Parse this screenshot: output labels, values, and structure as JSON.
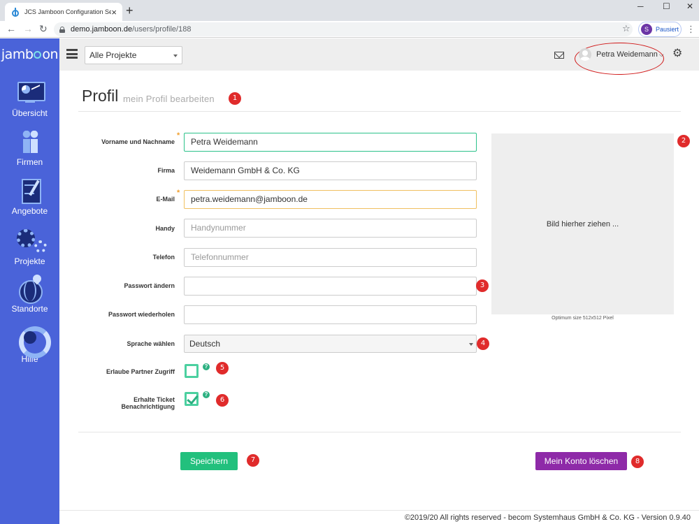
{
  "browser": {
    "tab_title": "JCS Jamboon Configuration Serv",
    "url_host": "demo.jamboon.de",
    "url_path": "/users/profile/188",
    "profile_initial": "S",
    "profile_label": "Pausiert"
  },
  "app": {
    "logo_left": "jamb",
    "logo_right": "on"
  },
  "sidebar": {
    "items": [
      {
        "label": "Übersicht"
      },
      {
        "label": "Firmen"
      },
      {
        "label": "Angebote"
      },
      {
        "label": "Projekte"
      },
      {
        "label": "Standorte"
      },
      {
        "label": "Hilfe"
      }
    ]
  },
  "header": {
    "project_select": "Alle Projekte",
    "user_name": "Petra Weidemann"
  },
  "page": {
    "title": "Profil",
    "subtitle": "mein Profil bearbeiten"
  },
  "form": {
    "name": {
      "label": "Vorname und Nachname",
      "value": "Petra Weidemann"
    },
    "company": {
      "label": "Firma",
      "value": "Weidemann GmbH & Co. KG"
    },
    "email": {
      "label": "E-Mail",
      "value": "petra.weidemann@jamboon.de"
    },
    "mobile": {
      "label": "Handy",
      "placeholder": "Handynummer"
    },
    "phone": {
      "label": "Telefon",
      "placeholder": "Telefonnummer"
    },
    "password": {
      "label": "Passwort ändern"
    },
    "password_repeat": {
      "label": "Passwort wiederholen"
    },
    "language": {
      "label": "Sprache wählen",
      "value": "Deutsch"
    },
    "partner_access": {
      "label": "Erlaube Partner Zugriff",
      "checked": false
    },
    "ticket_notify": {
      "label_line1": "Erhalte Ticket",
      "label_line2": "Benachrichtigung",
      "checked": true
    },
    "required_mark": "*",
    "help_mark": "?"
  },
  "image_upload": {
    "dropzone_text": "Bild hierher ziehen ...",
    "hint": "Optimum size 512x512 Pixel"
  },
  "buttons": {
    "save": "Speichern",
    "delete_account": "Mein Konto löschen"
  },
  "badges": [
    "1",
    "2",
    "3",
    "4",
    "5",
    "6",
    "7",
    "8"
  ],
  "footer": {
    "text": "©2019/20 All rights reserved - becom Systemhaus GmbH & Co. KG - Version 0.9.40"
  },
  "colors": {
    "sidebar": "#4a63d9",
    "accent_green": "#22c07d",
    "danger_purple": "#8e2aa8",
    "badge_red": "#e02b2b",
    "required_orange": "#f0a030"
  }
}
